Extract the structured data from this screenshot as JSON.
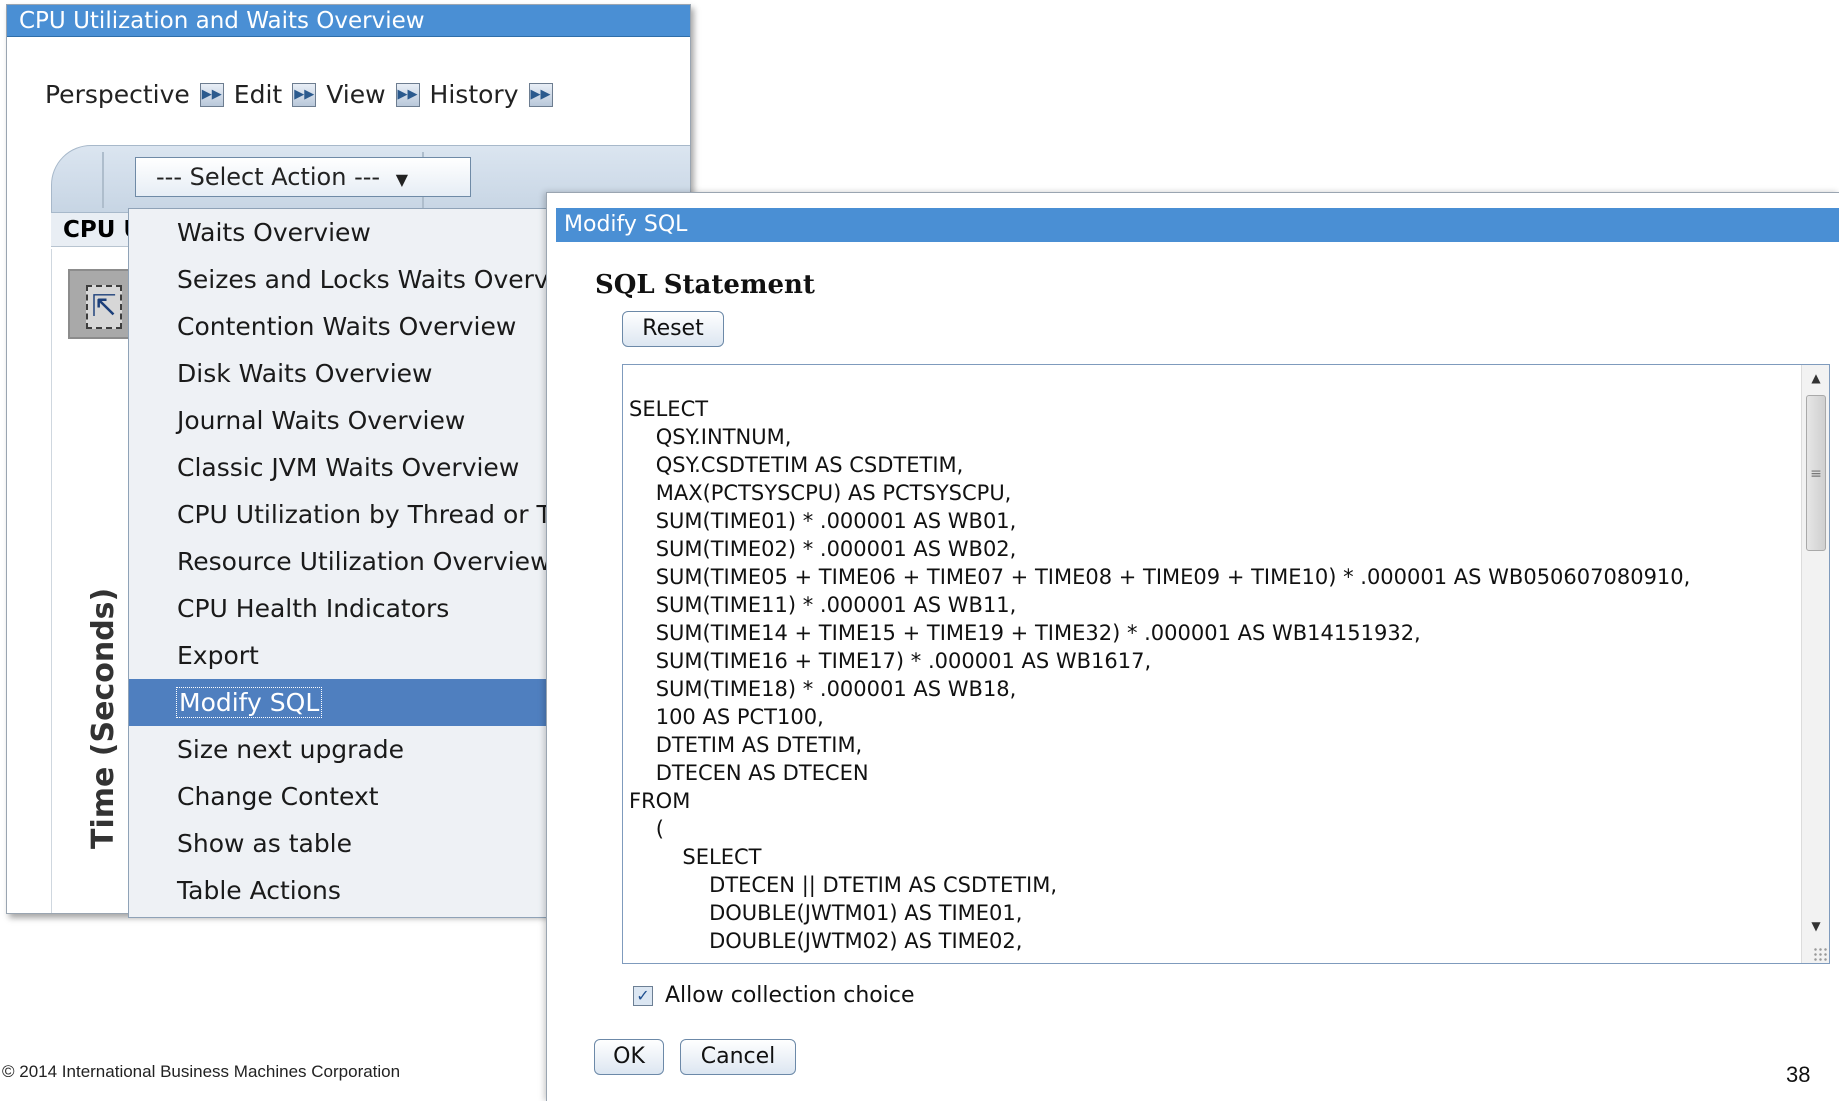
{
  "background_window": {
    "title": "CPU Utilization and Waits Overview",
    "menu": [
      {
        "label": "Perspective"
      },
      {
        "label": "Edit"
      },
      {
        "label": "View"
      },
      {
        "label": "History"
      }
    ],
    "select_action_label": "--- Select Action ---",
    "chart_header": "CPU U",
    "y_axis_label": "Time (Seconds)"
  },
  "dropdown": {
    "items": [
      "Waits Overview",
      "Seizes and Locks Waits Overview",
      "Contention Waits Overview",
      "Disk Waits Overview",
      "Journal Waits Overview",
      "Classic JVM Waits Overview",
      "CPU Utilization by Thread or Task",
      "Resource Utilization Overview",
      "CPU Health Indicators",
      "Export",
      "Modify SQL",
      "Size next upgrade",
      "Change Context",
      "Show as table",
      "Table Actions"
    ],
    "selected": "Modify SQL"
  },
  "dialog": {
    "title": "Modify SQL",
    "heading": "SQL Statement",
    "reset_label": "Reset",
    "sql_text": "SELECT\n\tQSY.INTNUM,\n\tQSY.CSDTETIM AS CSDTETIM,\n\tMAX(PCTSYSCPU) AS PCTSYSCPU,\n\tSUM(TIME01) * .000001 AS WB01,\n\tSUM(TIME02) * .000001 AS WB02,\n\tSUM(TIME05 + TIME06 + TIME07 + TIME08 + TIME09 + TIME10) * .000001 AS WB050607080910,\n\tSUM(TIME11) * .000001 AS WB11,\n\tSUM(TIME14 + TIME15 + TIME19 + TIME32) * .000001 AS WB14151932,\n\tSUM(TIME16 + TIME17) * .000001 AS WB1617,\n\tSUM(TIME18) * .000001 AS WB18,\n\t100 AS PCT100,\n\tDTETIM AS DTETIM,\n\tDTECEN AS DTECEN\nFROM\n\t(\n\t\tSELECT\n\t\t\tDTECEN || DTETIM AS CSDTETIM,\n\t\t\tDOUBLE(JWTM01) AS TIME01,\n\t\t\tDOUBLE(JWTM02) AS TIME02,",
    "checkbox_label": "Allow collection choice",
    "checkbox_checked": true,
    "ok_label": "OK",
    "cancel_label": "Cancel"
  },
  "footer": {
    "copyright": "© 2014 International Business Machines Corporation",
    "page_number": "38"
  },
  "colors": {
    "titlebar": "#4a8fd4",
    "selected_item": "#4f7fbf"
  }
}
